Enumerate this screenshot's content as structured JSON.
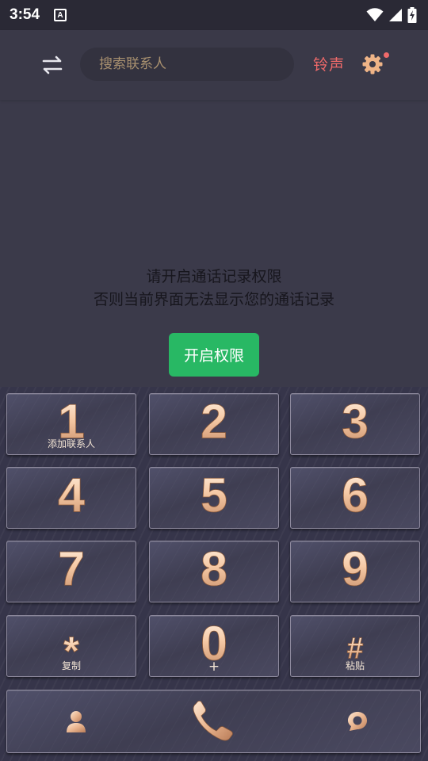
{
  "status_bar": {
    "time": "3:54",
    "notification_letter": "A"
  },
  "header": {
    "search_placeholder": "搜索联系人",
    "ringtone_label": "铃声"
  },
  "permission": {
    "line1": "请开启通话记录权限",
    "line2": "否则当前界面无法显示您的通话记录",
    "button_label": "开启权限"
  },
  "keypad": {
    "keys": [
      {
        "digit": "1",
        "sub": "添加联系人"
      },
      {
        "digit": "2",
        "sub": ""
      },
      {
        "digit": "3",
        "sub": ""
      },
      {
        "digit": "4",
        "sub": ""
      },
      {
        "digit": "5",
        "sub": ""
      },
      {
        "digit": "6",
        "sub": ""
      },
      {
        "digit": "7",
        "sub": ""
      },
      {
        "digit": "8",
        "sub": ""
      },
      {
        "digit": "9",
        "sub": ""
      },
      {
        "digit": "*",
        "sub": "复制"
      },
      {
        "digit": "0",
        "sub": "+"
      },
      {
        "digit": "#",
        "sub": "粘贴"
      }
    ]
  },
  "actions": {
    "icons": [
      "contacts-icon",
      "phone-call-icon",
      "chat-icon"
    ]
  },
  "colors": {
    "background": "#3b3a4a",
    "accent_red": "#f06a6a",
    "accent_green": "#28b864",
    "digit_gold": "#f4c9a6"
  }
}
